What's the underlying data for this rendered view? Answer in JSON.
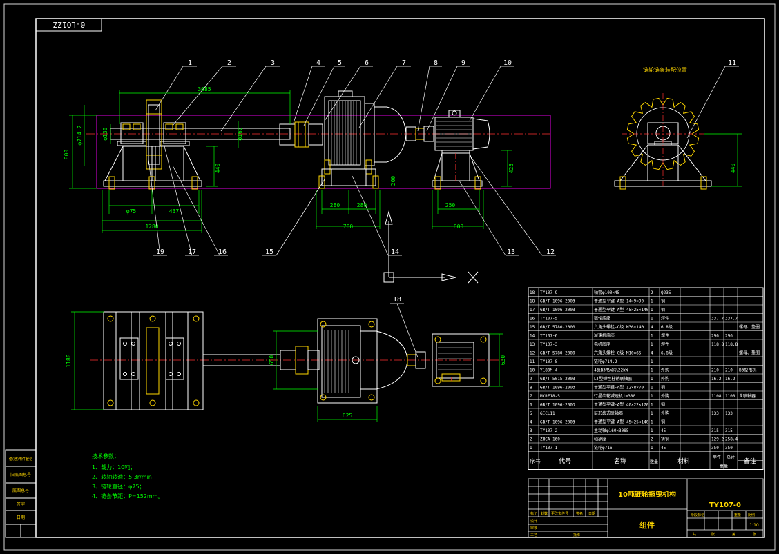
{
  "drawing": {
    "code_tag": "0-LO1ZZ",
    "title_cn": "10吨链轮拖曳机构",
    "drawing_no": "TY107-0",
    "assembly": "组件",
    "scale": "1:10",
    "view_label_right": "链轮链条装配位置",
    "axis_x_label": "X"
  },
  "callouts": [
    "1",
    "2",
    "3",
    "4",
    "5",
    "6",
    "7",
    "8",
    "9",
    "10",
    "11",
    "12",
    "13",
    "14",
    "15",
    "16",
    "17",
    "18",
    "19"
  ],
  "dimensions": {
    "span_top": "3085",
    "height_left": "800",
    "dia_left": "φ714.2",
    "h_440a": "440",
    "h_440b": "440",
    "h_425": "425",
    "d_160": "φ160",
    "d_130": "φ130",
    "d_280a": "280",
    "d_280b": "280",
    "d_700": "700",
    "d_250": "250",
    "d_600": "600",
    "d_475": "φ75",
    "d_437": "437",
    "d_1280": "1280",
    "d_200": "200",
    "plan_1180": "1180",
    "plan_650": "650",
    "plan_630": "630",
    "plan_625": "625"
  },
  "tech_notes": {
    "heading": "技术参数：",
    "lines": [
      "1、载力：10吨；",
      "2、转轴转速：5.3r/min",
      "3、链轮直径：φ75；",
      "4、链条节距：P=152mm。"
    ]
  },
  "bom": {
    "headers": {
      "no": "序号",
      "code": "代号",
      "name": "名称",
      "qty": "数量",
      "material": "材料",
      "unit": "单件",
      "total": "总计",
      "weight": "重量",
      "note": "备注"
    },
    "rows": [
      [
        "18",
        "TY107-9",
        "轴套φ100×45",
        "2",
        "Q235",
        "",
        "",
        ""
      ],
      [
        "18",
        "GB/T 1096-2003",
        "普通型平键-A型 14×9×90",
        "1",
        "钢",
        "",
        "",
        ""
      ],
      [
        "17",
        "GB/T 1096-2003",
        "普通型平键-A型 45×25×140",
        "1",
        "钢",
        "",
        "",
        ""
      ],
      [
        "16",
        "TY107-5",
        "链轮底座",
        "1",
        "焊件",
        "337.7",
        "337.7",
        ""
      ],
      [
        "15",
        "GB/T 5780-2000",
        "六角头螺栓-C级 M36×140",
        "4",
        "6.8级",
        "",
        "",
        "螺母、垫圈"
      ],
      [
        "14",
        "TY107-6",
        "减速机底座",
        "1",
        "焊件",
        "296",
        "296",
        ""
      ],
      [
        "13",
        "TY107-3",
        "电机底座",
        "1",
        "焊件",
        "118.8",
        "118.8",
        ""
      ],
      [
        "12",
        "GB/T 5780-2000",
        "六角头螺栓-C级 M10×65",
        "4",
        "6.8级",
        "",
        "",
        "螺母、垫圈"
      ],
      [
        "11",
        "TY107-8",
        "链轮φ714.2",
        "1",
        "",
        "",
        "",
        ""
      ],
      [
        "10",
        "Y180M-4",
        "4极B3电动机22kW",
        "1",
        "外购",
        "210",
        "210",
        "B3型电机"
      ],
      [
        "9",
        "GB/T 5015-2003",
        "LT型弹性柱销联轴器",
        "1",
        "外购",
        "16.2",
        "16.2",
        ""
      ],
      [
        "8",
        "GB/T 1096-2003",
        "普通型平键-A型 12×8×70",
        "1",
        "钢",
        "",
        "",
        ""
      ],
      [
        "7",
        "MCRF18-5",
        "行星齿轮减速机i=380",
        "1",
        "外购",
        "1108",
        "1108",
        "含联轴器"
      ],
      [
        "6",
        "GB/T 1096-2003",
        "普通型平键-A型 40×22×170",
        "1",
        "钢",
        "",
        "",
        ""
      ],
      [
        "5",
        "GICL11",
        "鼓形齿式联轴器",
        "1",
        "外购",
        "133",
        "133",
        ""
      ],
      [
        "4",
        "GB/T 1096-2003",
        "普通型平键-A型 45×25×140",
        "1",
        "钢",
        "",
        "",
        ""
      ],
      [
        "3",
        "TY107-2",
        "主动轴φ160×3085",
        "1",
        "45",
        "315",
        "315",
        ""
      ],
      [
        "2",
        "ZHCA-160",
        "轴承座",
        "2",
        "铸钢",
        "129.2",
        "258.4",
        ""
      ],
      [
        "1",
        "TY107-1",
        "链轮φ716",
        "1",
        "45",
        "350",
        "350",
        ""
      ]
    ]
  },
  "titleblock": {
    "row_labels": [
      "标记",
      "处数",
      "更改文件号",
      "签名",
      "日期"
    ],
    "role_labels": [
      "设计",
      "审核",
      "工艺",
      "批准"
    ],
    "stage_labels": [
      "阶段标记",
      "重量",
      "比例"
    ],
    "sheet_labels": [
      "共",
      "张",
      "第",
      "张"
    ]
  },
  "left_strip": [
    "借(通)用件登记",
    "旧底图总号",
    "底图总号",
    "签字",
    "日期"
  ]
}
